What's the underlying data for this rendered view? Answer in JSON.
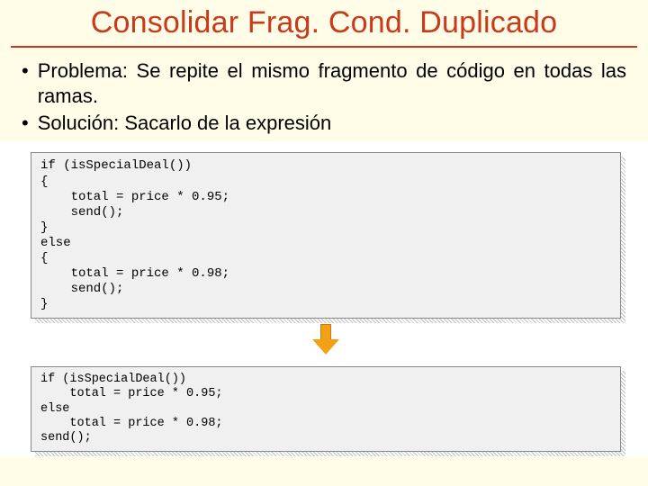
{
  "title": "Consolidar Frag. Cond. Duplicado",
  "bullets": {
    "b1_label": "Problema:",
    "b1_rest": " Se repite el mismo fragmento de código en todas las ramas.",
    "b2_label": "Solución:",
    "b2_rest": " Sacarlo de la expresión"
  },
  "code_before": "if (isSpecialDeal())\n{\n    total = price * 0.95;\n    send();\n}\nelse\n{\n    total = price * 0.98;\n    send();\n}",
  "code_after": "if (isSpecialDeal())\n    total = price * 0.95;\nelse\n    total = price * 0.98;\nsend();"
}
